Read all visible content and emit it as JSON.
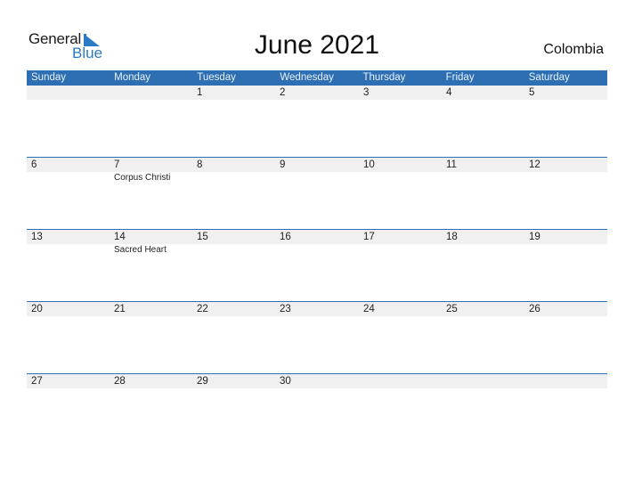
{
  "logo": {
    "word1": "General",
    "word2": "Blue",
    "brand_color": "#2a7bc4"
  },
  "title": "June 2021",
  "country": "Colombia",
  "colors": {
    "header_bg": "#2e6fb4",
    "date_strip": "#f0f0f0"
  },
  "weekdays": [
    "Sunday",
    "Monday",
    "Tuesday",
    "Wednesday",
    "Thursday",
    "Friday",
    "Saturday"
  ],
  "weeks": [
    {
      "days": [
        {
          "date": ""
        },
        {
          "date": ""
        },
        {
          "date": "1"
        },
        {
          "date": "2"
        },
        {
          "date": "3"
        },
        {
          "date": "4"
        },
        {
          "date": "5"
        }
      ]
    },
    {
      "days": [
        {
          "date": "6"
        },
        {
          "date": "7",
          "holiday": "Corpus Christi"
        },
        {
          "date": "8"
        },
        {
          "date": "9"
        },
        {
          "date": "10"
        },
        {
          "date": "11"
        },
        {
          "date": "12"
        }
      ]
    },
    {
      "days": [
        {
          "date": "13"
        },
        {
          "date": "14",
          "holiday": "Sacred Heart"
        },
        {
          "date": "15"
        },
        {
          "date": "16"
        },
        {
          "date": "17"
        },
        {
          "date": "18"
        },
        {
          "date": "19"
        }
      ]
    },
    {
      "days": [
        {
          "date": "20"
        },
        {
          "date": "21"
        },
        {
          "date": "22"
        },
        {
          "date": "23"
        },
        {
          "date": "24"
        },
        {
          "date": "25"
        },
        {
          "date": "26"
        }
      ]
    },
    {
      "days": [
        {
          "date": "27"
        },
        {
          "date": "28"
        },
        {
          "date": "29"
        },
        {
          "date": "30"
        },
        {
          "date": ""
        },
        {
          "date": ""
        },
        {
          "date": ""
        }
      ]
    }
  ]
}
